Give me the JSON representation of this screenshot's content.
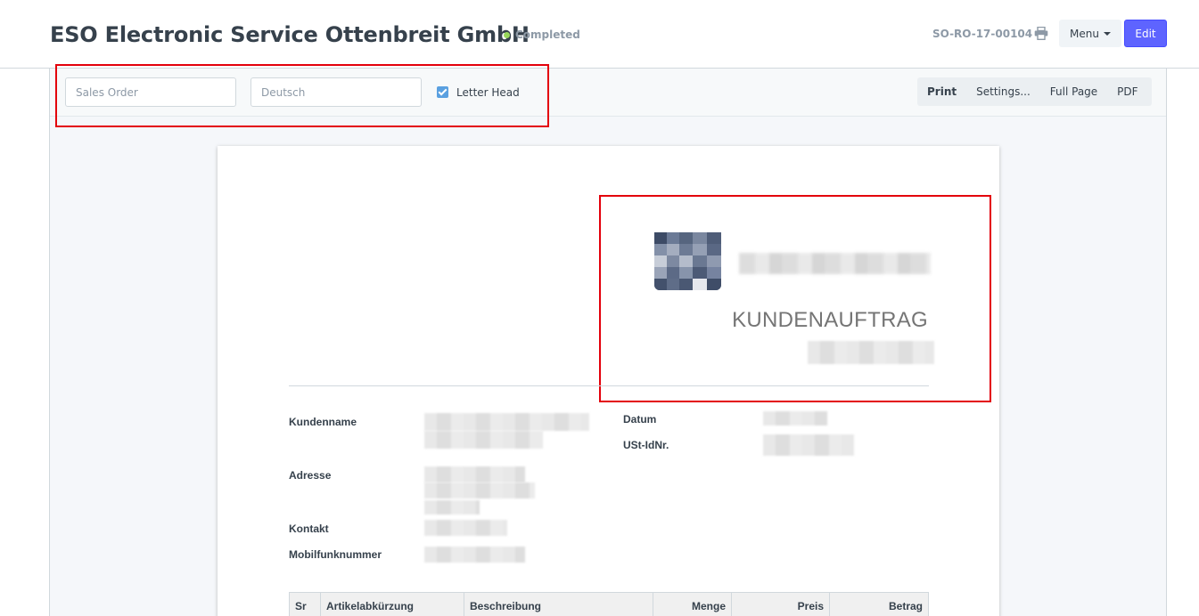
{
  "header": {
    "title": "ESO Electronic Service Ottenbreit GmbH",
    "status": "Completed",
    "doc_name": "SO-RO-17-00104",
    "menu_label": "Menu",
    "edit_label": "Edit"
  },
  "toolbar": {
    "print_format": "Sales Order",
    "language": "Deutsch",
    "letter_head_label": "Letter Head",
    "letter_head_checked": true,
    "actions": [
      "Print",
      "Settings...",
      "Full Page",
      "PDF"
    ]
  },
  "document": {
    "heading": "KUNDENAUFTRAG",
    "fields": {
      "customer_name": "Kundenname",
      "address": "Adresse",
      "contact": "Kontakt",
      "mobile": "Mobilfunknummer",
      "date": "Datum",
      "vat_id": "USt-IdNr."
    },
    "table_headers": [
      "Sr",
      "Artikelabkürzung",
      "Beschreibung",
      "Menge",
      "Preis",
      "Betrag"
    ]
  },
  "colors": {
    "primary": "#5e64ff",
    "status_dot": "#98d85b",
    "highlight": "#e3000b"
  }
}
